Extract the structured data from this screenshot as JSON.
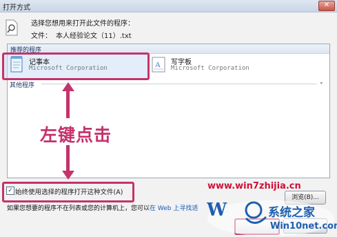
{
  "window": {
    "title": "打开方式",
    "close_glyph": "✕"
  },
  "header": {
    "prompt": "选择您想用来打开此文件的程序：",
    "file_label": "文件：",
    "file_name": "本人经验论文（11）.txt"
  },
  "recommended": {
    "label": "推荐的程序",
    "programs": [
      {
        "name": "记事本",
        "company": "Microsoft Corporation",
        "icon": "notepad-icon"
      },
      {
        "name": "写字板",
        "company": "Microsoft Corporation",
        "icon": "wordpad-icon"
      }
    ]
  },
  "other": {
    "label": "其他程序",
    "chevron": "⌄"
  },
  "annotation": {
    "text": "左键点击",
    "color": "#c4336b"
  },
  "always_use": {
    "checked": true,
    "check_glyph": "✓",
    "label": "始终使用选择的程序打开这种文件(A)"
  },
  "browse_button": {
    "label": "浏览(B)..."
  },
  "hint": {
    "prefix": "如果您想要的程序不在列表或您的计算机上，您可以",
    "link": "在 Web 上寻找适"
  },
  "watermark": {
    "url": "www.win7zhijia.cn",
    "brand": "系统之家",
    "site": "Win10net.com"
  },
  "colors": {
    "accent": "#c4336b",
    "link": "#1a56b8",
    "brand_blue": "#1d5fb0",
    "watermark_red": "#d0103a"
  }
}
